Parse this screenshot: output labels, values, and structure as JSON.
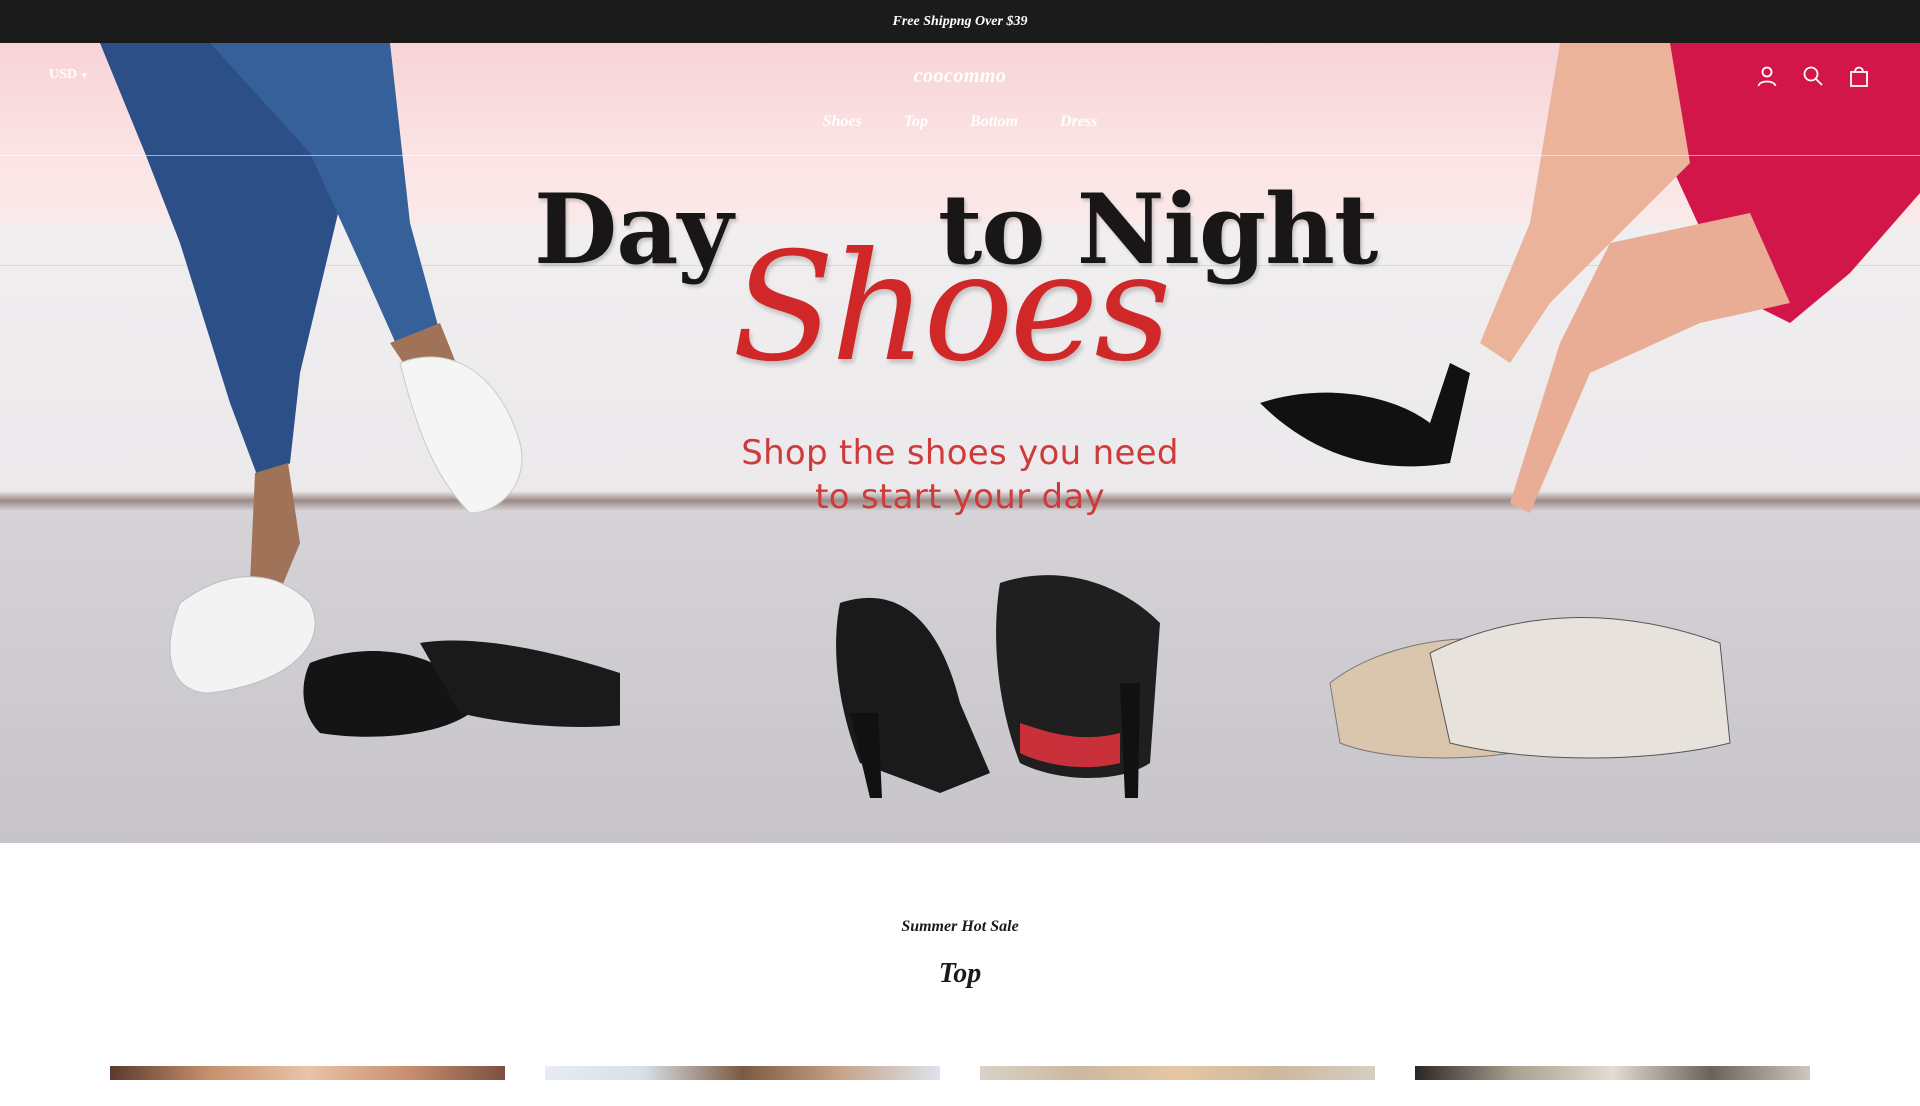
{
  "announcement": {
    "text": "Free Shippng Over $39"
  },
  "header": {
    "currency": "USD",
    "logo": "coocommo",
    "nav": [
      {
        "label": "Shoes"
      },
      {
        "label": "Top"
      },
      {
        "label": "Bottom"
      },
      {
        "label": "Dress"
      }
    ],
    "icons": [
      "account-icon",
      "search-icon",
      "cart-icon"
    ]
  },
  "hero": {
    "title_part1": "Day",
    "title_part2": "to Night",
    "title_script": "Shoes",
    "subtitle_line1": "Shop the shoes you need",
    "subtitle_line2": "to  start your day"
  },
  "section": {
    "kicker": "Summer Hot Sale",
    "title": "Top"
  },
  "colors": {
    "announcement_bg": "#1c1b1b",
    "accent_red": "#d02828",
    "hero_pink": "#f7d3d6"
  }
}
